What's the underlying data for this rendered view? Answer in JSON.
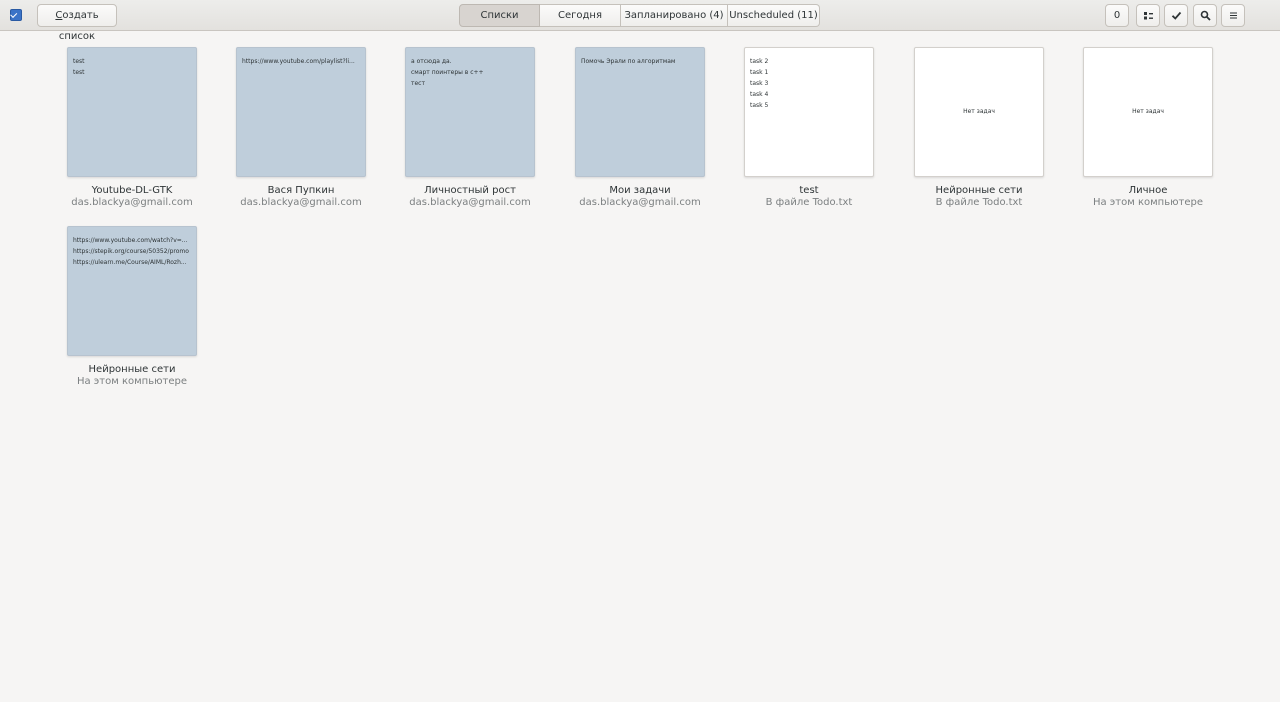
{
  "header": {
    "create_list_label": "Создать список",
    "create_list_mnemonic": "С",
    "create_list_rest": "оздать список",
    "tabs": [
      {
        "label": "Списки"
      },
      {
        "label": "Сегодня"
      },
      {
        "label": "Запланировано (4)"
      },
      {
        "label": "Unscheduled (11)"
      }
    ],
    "count_label": "0",
    "icons": {
      "app": "checkbox-app-icon",
      "view": "view-toggle-icon",
      "done": "checkmark-icon",
      "search": "search-icon",
      "menu": "hamburger-menu-icon"
    }
  },
  "lists": [
    {
      "name": "Youtube-DL-GTK",
      "source": "das.blackya@gmail.com",
      "lines": [
        "test",
        "test"
      ],
      "empty_text": ""
    },
    {
      "name": "Вася Пупкин",
      "source": "das.blackya@gmail.com",
      "lines": [
        "https://www.youtube.com/playlist?li..."
      ],
      "empty_text": ""
    },
    {
      "name": "Личностный рост",
      "source": "das.blackya@gmail.com",
      "lines": [
        "а отсюда да.",
        "смарт поинтеры в с++",
        "тест"
      ],
      "empty_text": ""
    },
    {
      "name": "Мои задачи",
      "source": "das.blackya@gmail.com",
      "lines": [
        "Помочь Эрали по алгоритмам"
      ],
      "empty_text": ""
    },
    {
      "name": "test",
      "source": "В файле Todo.txt",
      "lines": [
        "task 2",
        "task 1",
        "task 3",
        "task 4",
        "task 5"
      ],
      "empty_text": ""
    },
    {
      "name": "Нейронные сети",
      "source": "В файле Todo.txt",
      "lines": [],
      "empty_text": "Нет задач"
    },
    {
      "name": "Личное",
      "source": "На этом компьютере",
      "lines": [],
      "empty_text": "Нет задач"
    },
    {
      "name": "Нейронные сети",
      "source": "На этом компьютере",
      "lines": [
        "https://www.youtube.com/watch?v=...",
        "https://stepik.org/course/50352/promo",
        "https://ulearn.me/Course/AIML/Rozh..."
      ],
      "empty_text": ""
    }
  ],
  "colors": {
    "card_blue": "#bfcedb",
    "card_white": "#ffffff",
    "background": "#f6f5f4",
    "accent": "#3b73c7"
  }
}
